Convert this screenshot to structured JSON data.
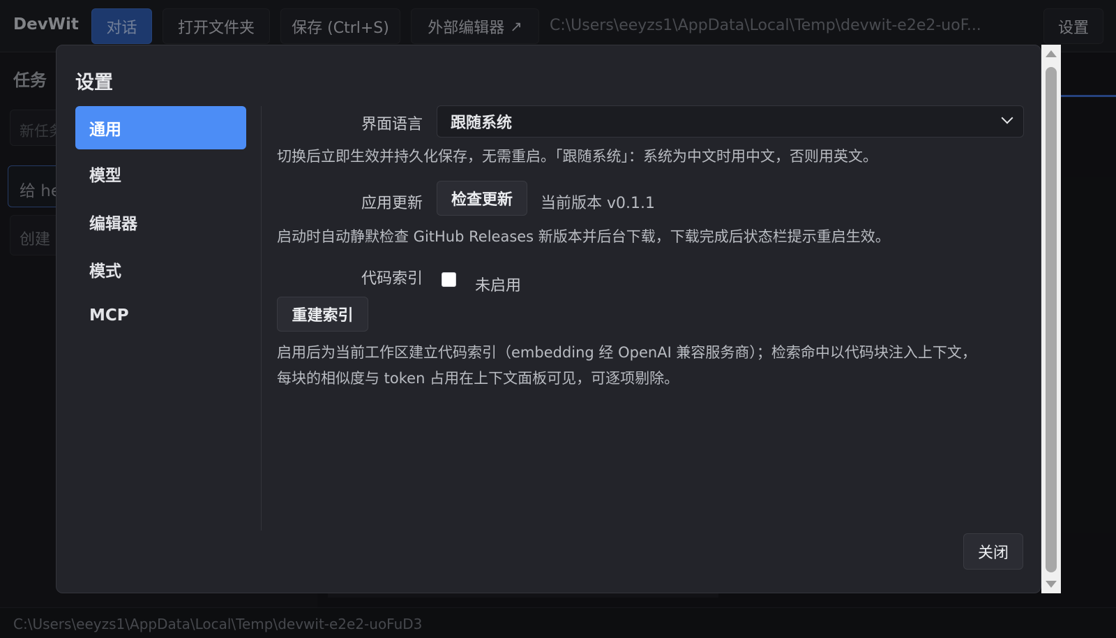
{
  "app": {
    "brand": "DevWit",
    "toolbar": {
      "chat_tab": "对话",
      "open_folder": "打开文件夹",
      "save": "保存 (Ctrl+S)",
      "external_editor": "外部编辑器",
      "external_arrow": "↗",
      "workspace_path": "C:\\Users\\eeyzs1\\AppData\\Local\\Temp\\devwit-e2e2-uoF...",
      "settings": "设置"
    },
    "sidebar": {
      "title": "任务",
      "new_task_placeholder": "新任务",
      "current_input": "给 he",
      "create": "创建"
    },
    "statusbar": {
      "path": "C:\\Users\\eeyzs1\\AppData\\Local\\Temp\\devwit-e2e2-uoFuD3"
    }
  },
  "settings_dialog": {
    "title": "设置",
    "nav": [
      {
        "label": "通用",
        "active": true
      },
      {
        "label": "模型",
        "active": false
      },
      {
        "label": "编辑器",
        "active": false
      },
      {
        "label": "模式",
        "active": false
      },
      {
        "label": "MCP",
        "active": false
      }
    ],
    "general": {
      "language_label": "界面语言",
      "language_value": "跟随系统",
      "language_help": "切换后立即生效并持久化保存，无需重启。「跟随系统」：系统为中文时用中文，否则用英文。",
      "update_label": "应用更新",
      "check_update_button": "检查更新",
      "current_version": "当前版本 v0.1.1",
      "update_help": "启动时自动静默检查 GitHub Releases 新版本并后台下载，下载完成后状态栏提示重启生效。",
      "index_label": "代码索引",
      "index_checked": false,
      "index_status": "未启用",
      "rebuild_button": "重建索引",
      "index_help_line1": "启用后为当前工作区建立代码索引（embedding 经 OpenAI 兼容服务商）；检索命中以代码块注入上下文，",
      "index_help_line2": "每块的相似度与 token 占用在上下文面板可见，可逐项剔除。"
    },
    "close_button": "关闭"
  },
  "colors": {
    "accent": "#4c8df6",
    "toolbar_active": "#2d58a8",
    "modal_bg": "#23242a"
  }
}
